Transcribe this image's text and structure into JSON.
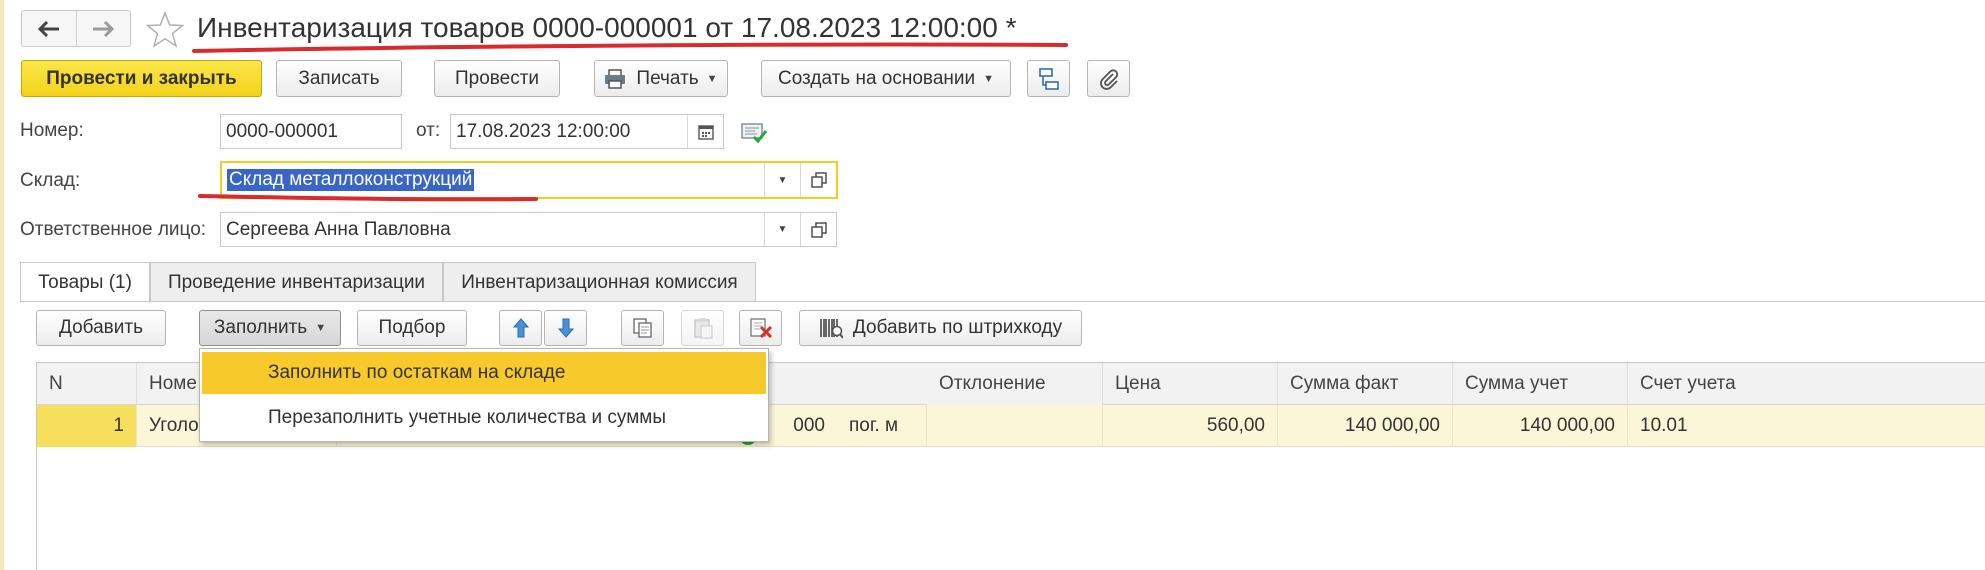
{
  "window": {
    "title": "Инвентаризация товаров 0000-000001 от 17.08.2023 12:00:00 *",
    "icons": {
      "back": "arrow-left-icon",
      "forward": "arrow-right-icon",
      "favorite": "star-icon"
    }
  },
  "toolbar": {
    "post_close": "Провести и закрыть",
    "save": "Записать",
    "post": "Провести",
    "print": "Печать",
    "create_based": "Создать на основании",
    "icons": {
      "structure": "hierarchy-icon",
      "attach": "paperclip-icon"
    }
  },
  "form": {
    "number_label": "Номер:",
    "number_value": "0000-000001",
    "date_label": "от:",
    "date_value": "17.08.2023 12:00:00",
    "warehouse_label": "Склад:",
    "warehouse_value": "Склад металлоконструкций",
    "responsible_label": "Ответственное лицо:",
    "responsible_value": "Сергеева Анна Павловна"
  },
  "tabs": [
    {
      "label": "Товары (1)",
      "active": true
    },
    {
      "label": "Проведение инвентаризации",
      "active": false
    },
    {
      "label": "Инвентаризационная комиссия",
      "active": false
    }
  ],
  "table_toolbar": {
    "add": "Добавить",
    "fill": "Заполнить",
    "pick": "Подбор",
    "barcode": "Добавить по штрихкоду"
  },
  "fill_menu": {
    "items": [
      "Заполнить по остаткам на складе",
      "Перезаполнить учетные количества и суммы"
    ],
    "highlighted_index": 0
  },
  "table": {
    "columns": [
      "N",
      "Номе",
      "Отклонение",
      "Цена",
      "Сумма факт",
      "Сумма учет",
      "Счет учета"
    ],
    "rows": [
      {
        "n": "1",
        "nomenclature": "Уголо",
        "qty_partial": "000",
        "unit": "пог. м",
        "deviation": "",
        "price": "560,00",
        "sum_fact": "140 000,00",
        "sum_account": "140 000,00",
        "account": "10.01"
      }
    ]
  },
  "colors": {
    "primary_button": "#f3d21a",
    "menu_highlight": "#f8c92a",
    "selected_row": "#fcf6d8",
    "annotation_red": "#d92b2b",
    "text_selection": "#3966c6"
  }
}
